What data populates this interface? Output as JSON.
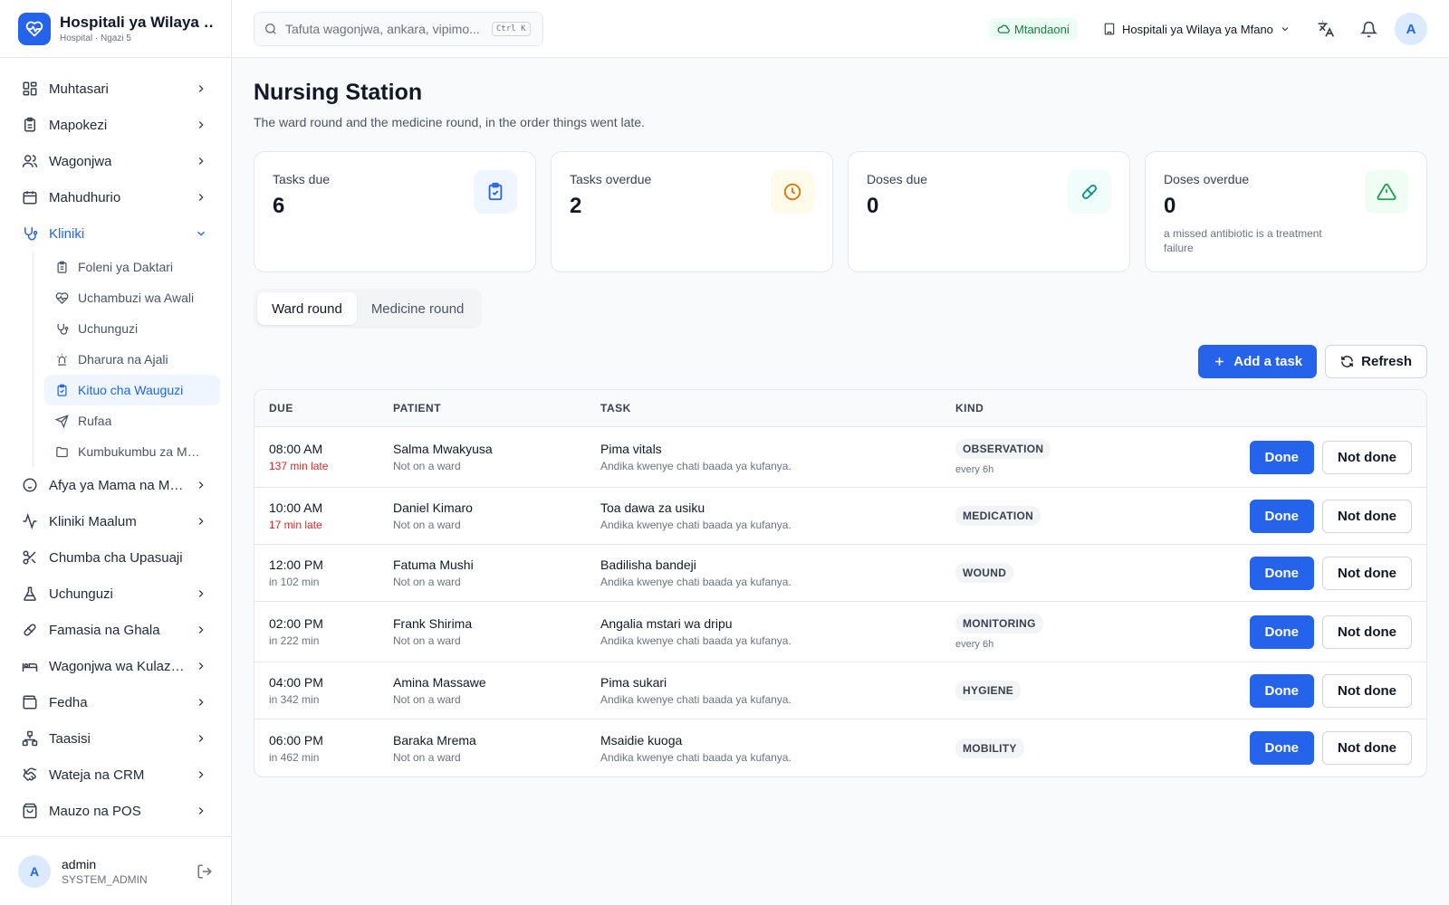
{
  "brand": {
    "title": "Hospitali ya Wilaya ya Mfano",
    "subtitle": "Hospital · Ngazi 5"
  },
  "sidebar": {
    "items": [
      {
        "label": "Muhtasari",
        "icon": "dashboard-icon"
      },
      {
        "label": "Mapokezi",
        "icon": "clipboard-icon"
      },
      {
        "label": "Wagonjwa",
        "icon": "users-icon"
      },
      {
        "label": "Mahudhurio",
        "icon": "calendar-icon"
      },
      {
        "label": "Kliniki",
        "icon": "stethoscope-icon"
      },
      {
        "label": "Afya ya Mama na Mtoto",
        "icon": "baby-icon"
      },
      {
        "label": "Kliniki Maalum",
        "icon": "activity-icon"
      },
      {
        "label": "Chumba cha Upasuaji",
        "icon": "scissors-icon"
      },
      {
        "label": "Uchunguzi",
        "icon": "flask-icon"
      },
      {
        "label": "Famasia na Ghala",
        "icon": "pill-icon"
      },
      {
        "label": "Wagonjwa wa Kulazwa",
        "icon": "bed-icon"
      },
      {
        "label": "Fedha",
        "icon": "wallet-icon"
      },
      {
        "label": "Taasisi",
        "icon": "network-icon"
      },
      {
        "label": "Wateja na CRM",
        "icon": "handshake-icon"
      },
      {
        "label": "Mauzo na POS",
        "icon": "shopping-bag-icon"
      }
    ],
    "subitems": [
      {
        "label": "Foleni ya Daktari",
        "icon": "clipboard-list-icon"
      },
      {
        "label": "Uchambuzi wa Awali",
        "icon": "heart-pulse-icon"
      },
      {
        "label": "Uchunguzi",
        "icon": "stethoscope-icon"
      },
      {
        "label": "Dharura na Ajali",
        "icon": "siren-icon"
      },
      {
        "label": "Kituo cha Wauguzi",
        "icon": "clipboard-check-icon"
      },
      {
        "label": "Rufaa",
        "icon": "send-icon"
      },
      {
        "label": "Kumbukumbu za Matibabu",
        "icon": "folder-icon"
      }
    ]
  },
  "user": {
    "avatar": "A",
    "name": "admin",
    "role": "SYSTEM_ADMIN"
  },
  "topbar": {
    "search_placeholder": "Tafuta wagonjwa, ankara, vipimo...",
    "shortcut": "Ctrl K",
    "status": "Mtandaoni",
    "facility": "Hospitali ya Wilaya ya Mfano",
    "avatar": "A"
  },
  "page": {
    "title": "Nursing Station",
    "subtitle": "The ward round and the medicine round, in the order things went late."
  },
  "stats": [
    {
      "label": "Tasks due",
      "value": "6",
      "note": "",
      "icon": "clipboard-check-icon",
      "color": "#2563eb",
      "bg": "#eff6ff"
    },
    {
      "label": "Tasks overdue",
      "value": "2",
      "note": "",
      "icon": "clock-icon",
      "color": "#d97706",
      "bg": "#fffbeb"
    },
    {
      "label": "Doses due",
      "value": "0",
      "note": "",
      "icon": "pill-icon",
      "color": "#0d9488",
      "bg": "#f0fdfa"
    },
    {
      "label": "Doses overdue",
      "value": "0",
      "note": "a missed antibiotic is a treatment failure",
      "icon": "alert-triangle-icon",
      "color": "#16a34a",
      "bg": "#f0fdf4"
    }
  ],
  "tabs": [
    {
      "label": "Ward round"
    },
    {
      "label": "Medicine round"
    }
  ],
  "actions": {
    "add": "Add a task",
    "refresh": "Refresh"
  },
  "table": {
    "headers": {
      "due": "Due",
      "patient": "Patient",
      "task": "Task",
      "kind": "Kind"
    },
    "done_label": "Done",
    "not_done_label": "Not done",
    "rows": [
      {
        "time": "08:00 AM",
        "rel": "137 min late",
        "late": true,
        "patient": "Salma Mwakyusa",
        "ward": "Not on a ward",
        "task": "Pima vitals",
        "note": "Andika kwenye chati baada ya kufanya.",
        "kind": "OBSERVATION",
        "freq": "every 6h"
      },
      {
        "time": "10:00 AM",
        "rel": "17 min late",
        "late": true,
        "patient": "Daniel Kimaro",
        "ward": "Not on a ward",
        "task": "Toa dawa za usiku",
        "note": "Andika kwenye chati baada ya kufanya.",
        "kind": "MEDICATION",
        "freq": ""
      },
      {
        "time": "12:00 PM",
        "rel": "in 102 min",
        "late": false,
        "patient": "Fatuma Mushi",
        "ward": "Not on a ward",
        "task": "Badilisha bandeji",
        "note": "Andika kwenye chati baada ya kufanya.",
        "kind": "WOUND",
        "freq": ""
      },
      {
        "time": "02:00 PM",
        "rel": "in 222 min",
        "late": false,
        "patient": "Frank Shirima",
        "ward": "Not on a ward",
        "task": "Angalia mstari wa dripu",
        "note": "Andika kwenye chati baada ya kufanya.",
        "kind": "MONITORING",
        "freq": "every 6h"
      },
      {
        "time": "04:00 PM",
        "rel": "in 342 min",
        "late": false,
        "patient": "Amina Massawe",
        "ward": "Not on a ward",
        "task": "Pima sukari",
        "note": "Andika kwenye chati baada ya kufanya.",
        "kind": "HYGIENE",
        "freq": ""
      },
      {
        "time": "06:00 PM",
        "rel": "in 462 min",
        "late": false,
        "patient": "Baraka Mrema",
        "ward": "Not on a ward",
        "task": "Msaidie kuoga",
        "note": "Andika kwenye chati baada ya kufanya.",
        "kind": "MOBILITY",
        "freq": ""
      }
    ]
  },
  "colors": {
    "primary": "#2563eb",
    "late": "#dc2626",
    "online": "#15803d"
  }
}
